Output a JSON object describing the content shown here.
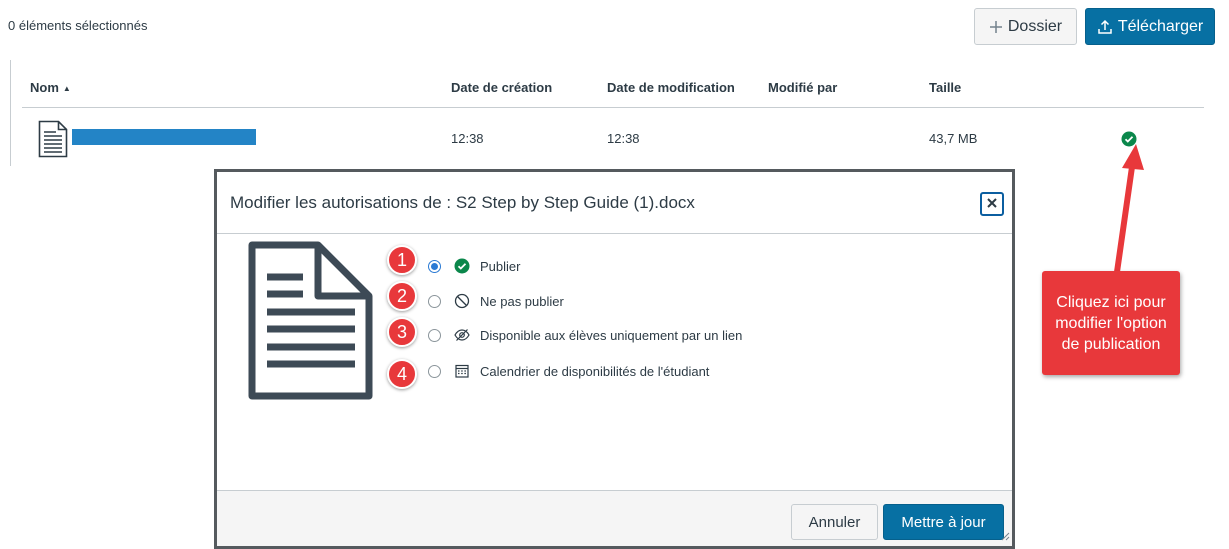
{
  "toolbar": {
    "selected_count": "0 éléments sélectionnés",
    "folder_button": "Dossier",
    "upload_button": "Télécharger"
  },
  "table": {
    "headers": {
      "name": "Nom",
      "created": "Date de création",
      "modified": "Date de modification",
      "modified_by": "Modifié par",
      "size": "Taille"
    },
    "rows": [
      {
        "created": "12:38",
        "modified": "12:38",
        "modified_by": "",
        "size": "43,7 MB",
        "status": "published"
      }
    ]
  },
  "dialog": {
    "title": "Modifier les autorisations de : S2 Step by Step Guide (1).docx",
    "options": [
      {
        "step": "1",
        "label": "Publier",
        "icon": "published-check-icon",
        "selected": true
      },
      {
        "step": "2",
        "label": "Ne pas publier",
        "icon": "not-published-icon",
        "selected": false
      },
      {
        "step": "3",
        "label": "Disponible aux élèves uniquement par un lien",
        "icon": "hidden-eye-icon",
        "selected": false
      },
      {
        "step": "4",
        "label": "Calendrier de disponibilités de l'étudiant",
        "icon": "calendar-icon",
        "selected": false
      }
    ],
    "cancel_button": "Annuler",
    "update_button": "Mettre à jour"
  },
  "callout": {
    "text": "Cliquez ici pour modifier l'option de publication"
  },
  "colors": {
    "primary_blue": "#0770a3",
    "success_green": "#0b874b",
    "annotation_red": "#e8383b",
    "text": "#2d3b45"
  }
}
